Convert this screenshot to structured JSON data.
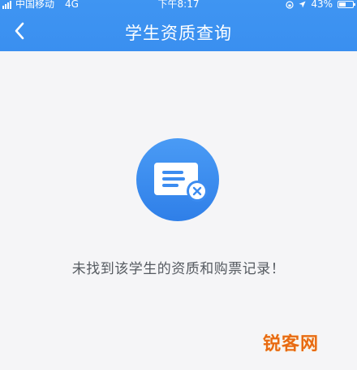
{
  "status_bar": {
    "carrier": "中国移动",
    "network": "4G",
    "time": "下午8:17",
    "battery": "43%"
  },
  "nav": {
    "title": "学生资质查询",
    "back_icon": "chevron-left-icon"
  },
  "empty_state": {
    "icon": "card-remove-icon",
    "message": "未找到该学生的资质和购票记录！"
  },
  "watermark": {
    "text": "锐客网"
  },
  "colors": {
    "header": "#3a8ff0",
    "background": "#f5f5f7",
    "icon_circle": "#3c8cf0",
    "message_text": "#555a60",
    "watermark": "#e86a12"
  }
}
